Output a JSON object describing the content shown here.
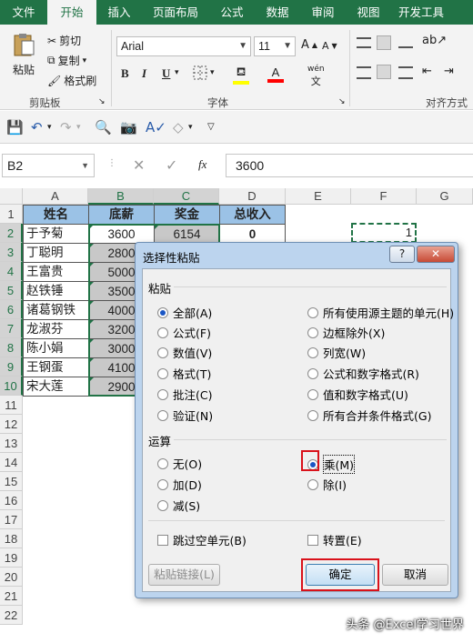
{
  "ribbon_tabs": [
    "文件",
    "开始",
    "插入",
    "页面布局",
    "公式",
    "数据",
    "审阅",
    "视图",
    "开发工具"
  ],
  "active_tab": "开始",
  "clipboard": {
    "paste": "粘贴",
    "cut": "剪切",
    "copy": "复制",
    "format_painter": "格式刷",
    "group_label": "剪贴板"
  },
  "font": {
    "name": "Arial",
    "size": "11",
    "group_label": "字体",
    "bold": "B",
    "italic": "I",
    "underline": "U",
    "wen": "wén"
  },
  "alignment": {
    "group_label": "对齐方式"
  },
  "colors": {
    "excel_green": "#217346",
    "header_fill": "#9bc2e6",
    "red_highlight": "#d9121b",
    "font_red": "#ff0000",
    "fill_yellow": "#ffff00"
  },
  "formula_bar": {
    "name_box": "B2",
    "fx": "fx",
    "value": "3600"
  },
  "columns": [
    "A",
    "B",
    "C",
    "D",
    "E",
    "F",
    "G"
  ],
  "rows": [
    "1",
    "2",
    "3",
    "4",
    "5",
    "6",
    "7",
    "8",
    "9",
    "10",
    "11",
    "12",
    "13",
    "14",
    "15",
    "16",
    "17",
    "18",
    "19",
    "20",
    "21",
    "22"
  ],
  "table": {
    "headers": [
      "姓名",
      "底薪",
      "奖金",
      "总收入"
    ],
    "rows": [
      [
        "于予菊",
        "3600",
        "6154",
        "0"
      ],
      [
        "丁聪明",
        "2800",
        "",
        ""
      ],
      [
        "王富贵",
        "5000",
        "",
        ""
      ],
      [
        "赵铁锤",
        "3500",
        "",
        ""
      ],
      [
        "诸葛钢铁",
        "4000",
        "",
        ""
      ],
      [
        "龙淑芬",
        "3200",
        "",
        ""
      ],
      [
        "陈小娟",
        "3000",
        "",
        ""
      ],
      [
        "王钢蛋",
        "4100",
        "",
        ""
      ],
      [
        "宋大莲",
        "2900",
        "",
        ""
      ]
    ],
    "f2_value": "1"
  },
  "dialog": {
    "title": "选择性粘贴",
    "help": "?",
    "close": "✕",
    "paste_section": "粘贴",
    "paste_options_left": [
      "全部(A)",
      "公式(F)",
      "数值(V)",
      "格式(T)",
      "批注(C)",
      "验证(N)"
    ],
    "paste_options_right": [
      "所有使用源主题的单元(H)",
      "边框除外(X)",
      "列宽(W)",
      "公式和数字格式(R)",
      "值和数字格式(U)",
      "所有合并条件格式(G)"
    ],
    "paste_selected": "全部(A)",
    "operation_section": "运算",
    "operation_left": [
      "无(O)",
      "加(D)",
      "减(S)"
    ],
    "operation_right": [
      "乘(M)",
      "除(I)"
    ],
    "operation_selected": "乘(M)",
    "skip_blanks": "跳过空单元(B)",
    "transpose": "转置(E)",
    "paste_link": "粘贴链接(L)",
    "ok": "确定",
    "cancel": "取消"
  },
  "watermark": "头条 @Excel学习世界"
}
